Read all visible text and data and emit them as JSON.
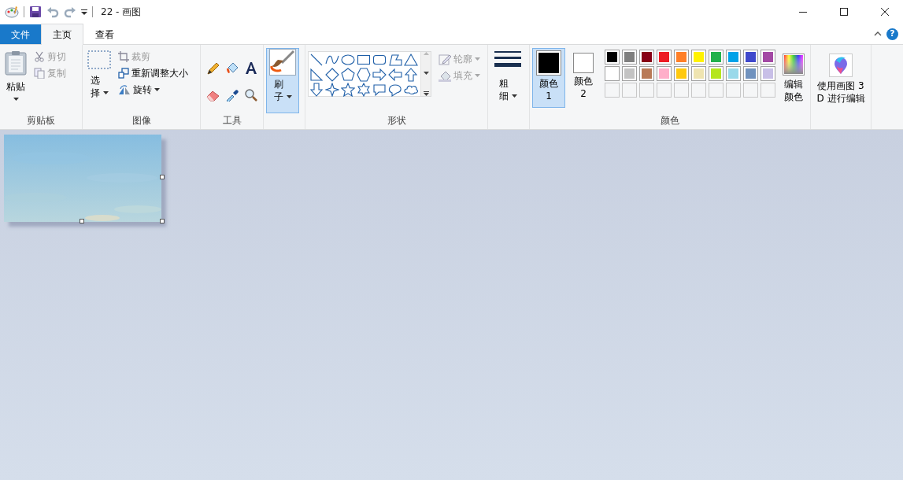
{
  "window": {
    "title": "22 - 画图"
  },
  "tabs": [
    {
      "label": "文件",
      "kind": "file",
      "selected": false
    },
    {
      "label": "主页",
      "kind": "tab",
      "selected": true
    },
    {
      "label": "查看",
      "kind": "tab",
      "selected": false
    }
  ],
  "help": "?",
  "clipboard": {
    "label": "剪贴板",
    "paste": "粘贴",
    "cut": {
      "label": "剪切",
      "disabled": true
    },
    "copy": {
      "label": "复制",
      "disabled": true
    }
  },
  "image": {
    "label": "图像",
    "select": "选择",
    "crop": {
      "label": "裁剪",
      "disabled": true
    },
    "resize": {
      "label": "重新调整大小",
      "disabled": false
    },
    "rotate": {
      "label": "旋转",
      "disabled": false
    }
  },
  "tools": {
    "label": "工具"
  },
  "brushes": {
    "label": "刷子",
    "selected": true
  },
  "shapes": {
    "label": "形状",
    "outline": {
      "label": "轮廓",
      "disabled": true
    },
    "fill": {
      "label": "填充",
      "disabled": true
    }
  },
  "size": {
    "label": "粗细"
  },
  "colors": {
    "label": "颜色",
    "color1": {
      "label": "颜色 1",
      "color": "#000000",
      "selected": true
    },
    "color2": {
      "label": "颜色 2",
      "color": "#ffffff",
      "selected": false
    },
    "palette": [
      {
        "kind": "swatch",
        "color": "#000000"
      },
      {
        "kind": "swatch",
        "color": "#7f7f7f"
      },
      {
        "kind": "swatch",
        "color": "#880015"
      },
      {
        "kind": "swatch",
        "color": "#ed1c24"
      },
      {
        "kind": "swatch",
        "color": "#ff7f27"
      },
      {
        "kind": "swatch",
        "color": "#fff200"
      },
      {
        "kind": "swatch",
        "color": "#22b14c"
      },
      {
        "kind": "swatch",
        "color": "#00a2e8"
      },
      {
        "kind": "swatch",
        "color": "#3f48cc"
      },
      {
        "kind": "swatch",
        "color": "#a349a4"
      },
      {
        "kind": "swatch",
        "color": "#ffffff"
      },
      {
        "kind": "swatch",
        "color": "#c3c3c3"
      },
      {
        "kind": "swatch",
        "color": "#b97a57"
      },
      {
        "kind": "swatch",
        "color": "#ffaec9"
      },
      {
        "kind": "swatch",
        "color": "#ffc90e"
      },
      {
        "kind": "swatch",
        "color": "#efe4b0"
      },
      {
        "kind": "swatch",
        "color": "#b5e61d"
      },
      {
        "kind": "swatch",
        "color": "#99d9ea"
      },
      {
        "kind": "swatch",
        "color": "#7092be"
      },
      {
        "kind": "swatch",
        "color": "#c8bfe7"
      },
      {
        "kind": "empty"
      },
      {
        "kind": "empty"
      },
      {
        "kind": "empty"
      },
      {
        "kind": "empty"
      },
      {
        "kind": "empty"
      },
      {
        "kind": "empty"
      },
      {
        "kind": "empty"
      },
      {
        "kind": "empty"
      },
      {
        "kind": "empty"
      },
      {
        "kind": "empty"
      }
    ],
    "edit": "编辑颜色"
  },
  "paint3d": {
    "label": "使用画图 3 D 进行编辑"
  }
}
